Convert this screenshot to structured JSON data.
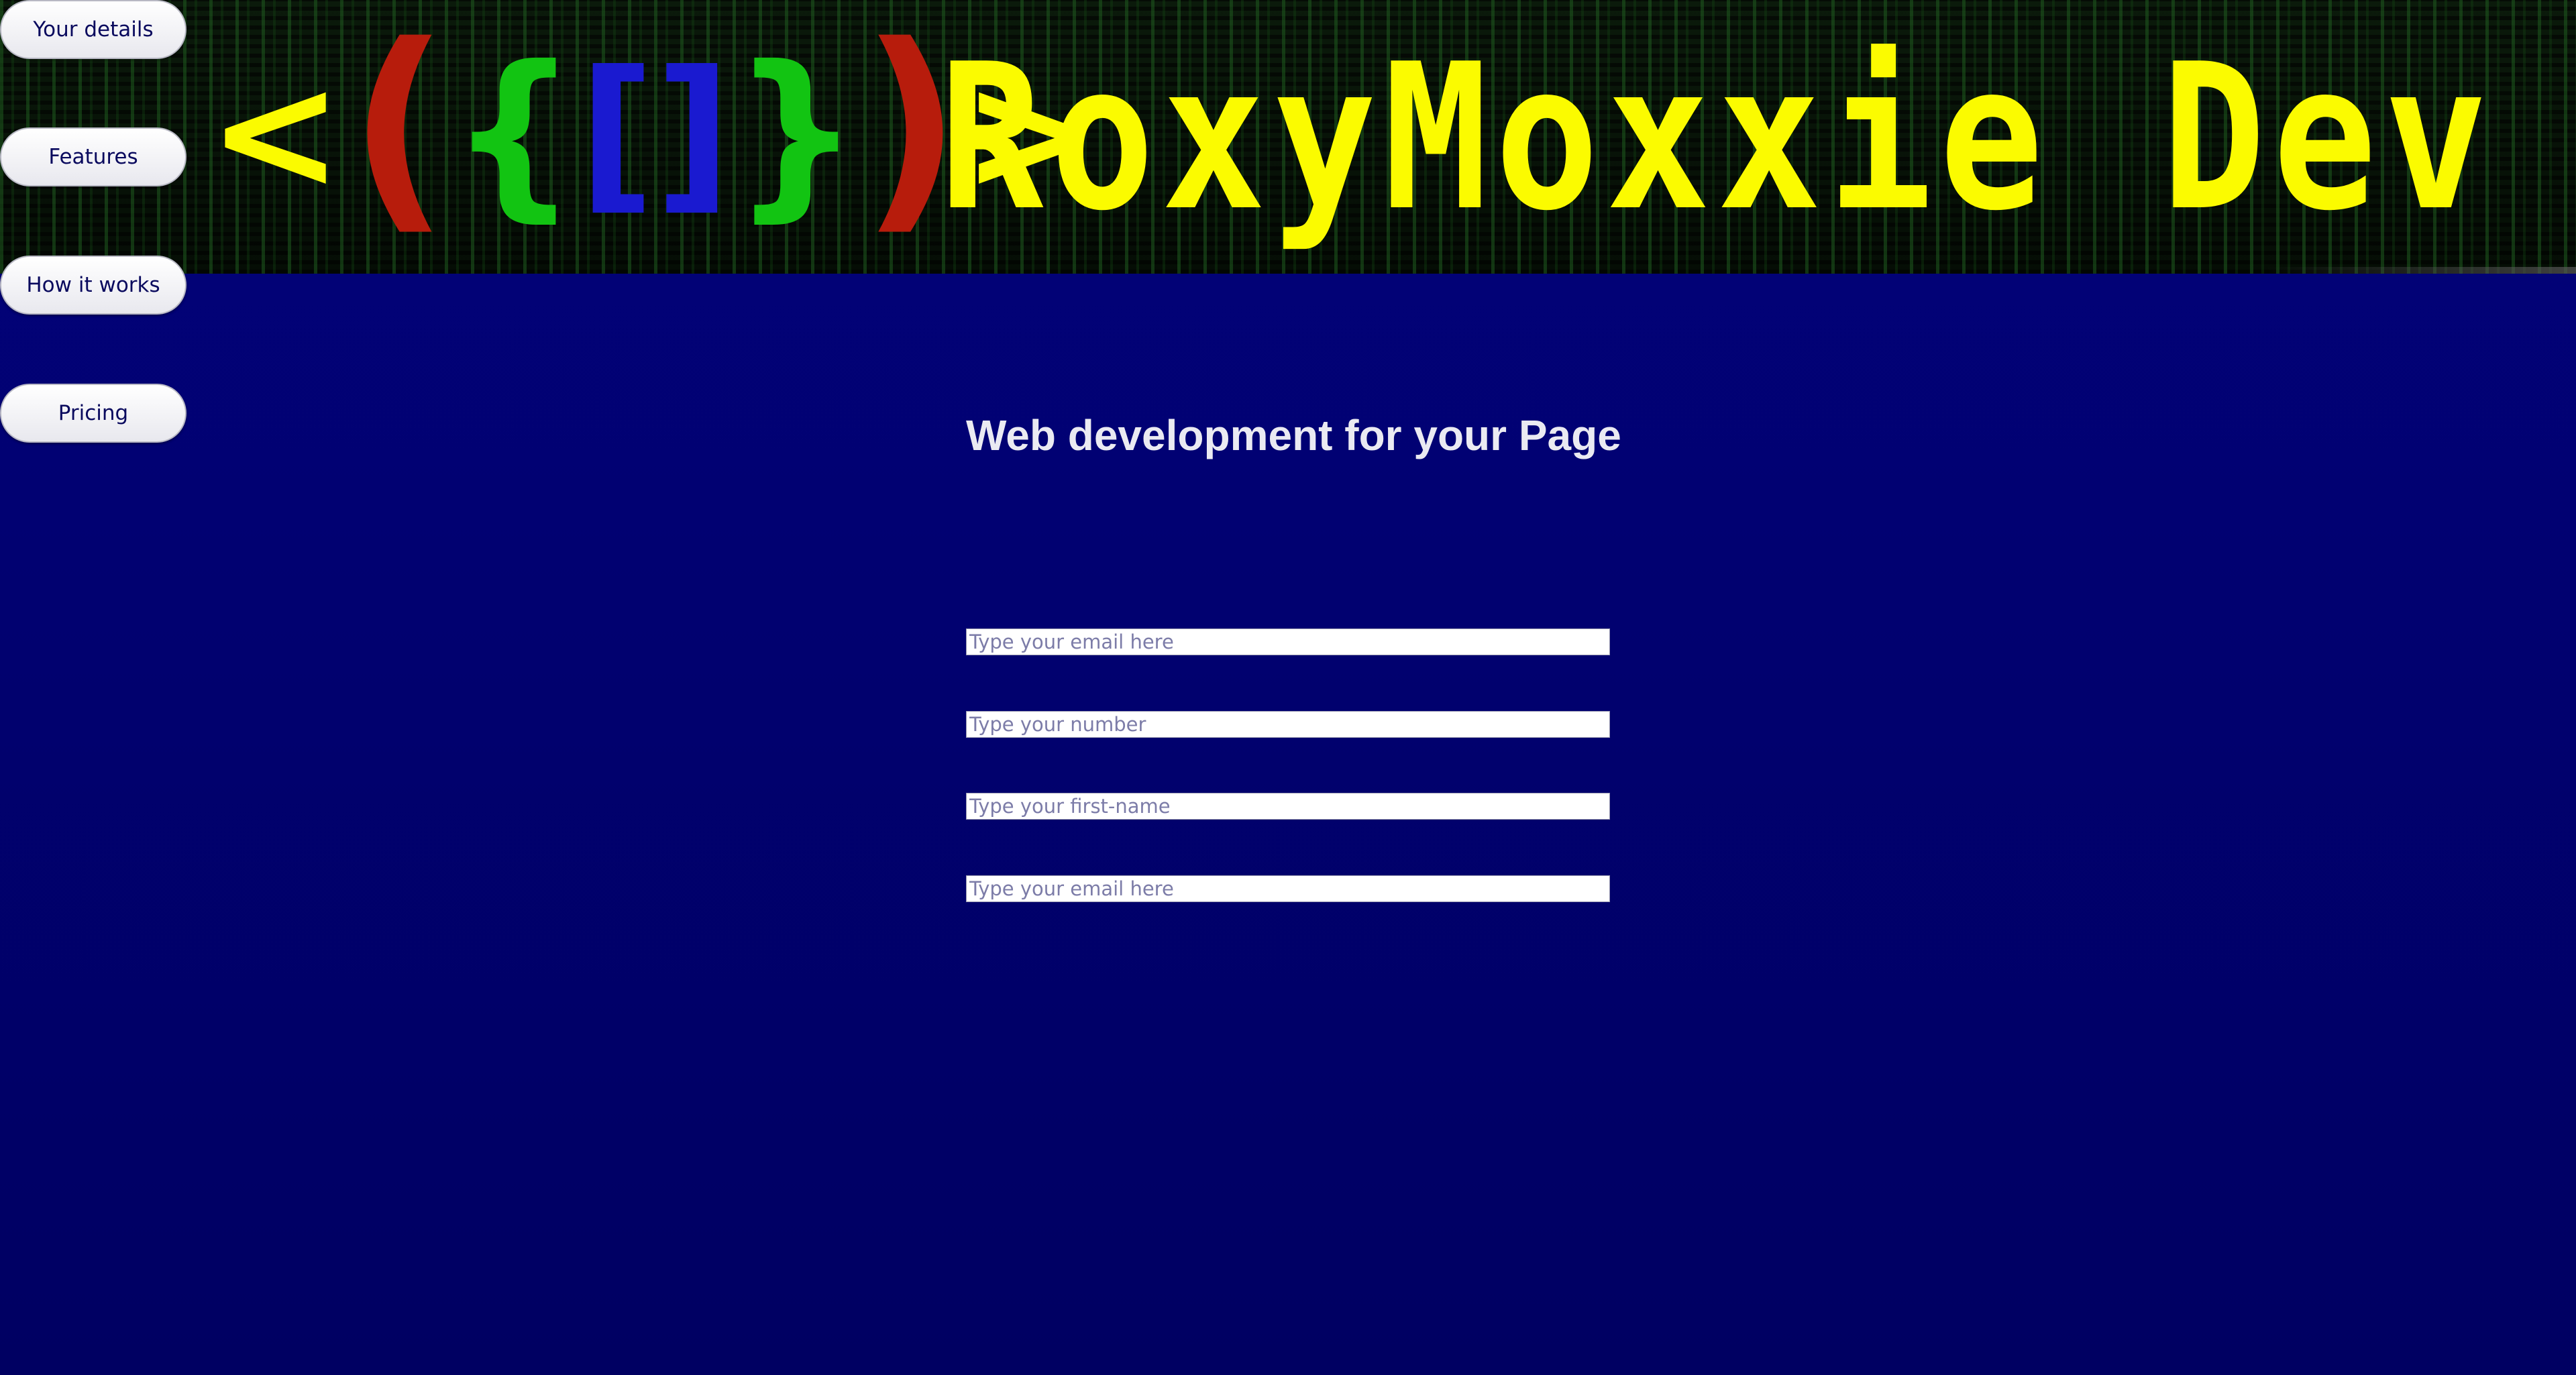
{
  "header": {
    "logo_glyphs": [
      "<",
      "(",
      "{",
      "[]",
      "}",
      ")",
      ">"
    ],
    "brand_name": "RoxyMoxxie Dev"
  },
  "nav": {
    "items": [
      {
        "label": "Your details"
      },
      {
        "label": "Features"
      },
      {
        "label": "How it works"
      },
      {
        "label": "Pricing"
      }
    ]
  },
  "main": {
    "title": "Web development for your Page",
    "fields": [
      {
        "placeholder": "Type your email here"
      },
      {
        "placeholder": "Type your number"
      },
      {
        "placeholder": "Type your first-name"
      },
      {
        "placeholder": "Type your email here"
      }
    ]
  },
  "colors": {
    "background": "#010170",
    "brand_yellow": "#fbfb00",
    "logo_red": "#b71c0c",
    "logo_green": "#12c412",
    "logo_blue": "#1a1ad0",
    "nav_text": "#0a0a5e"
  }
}
